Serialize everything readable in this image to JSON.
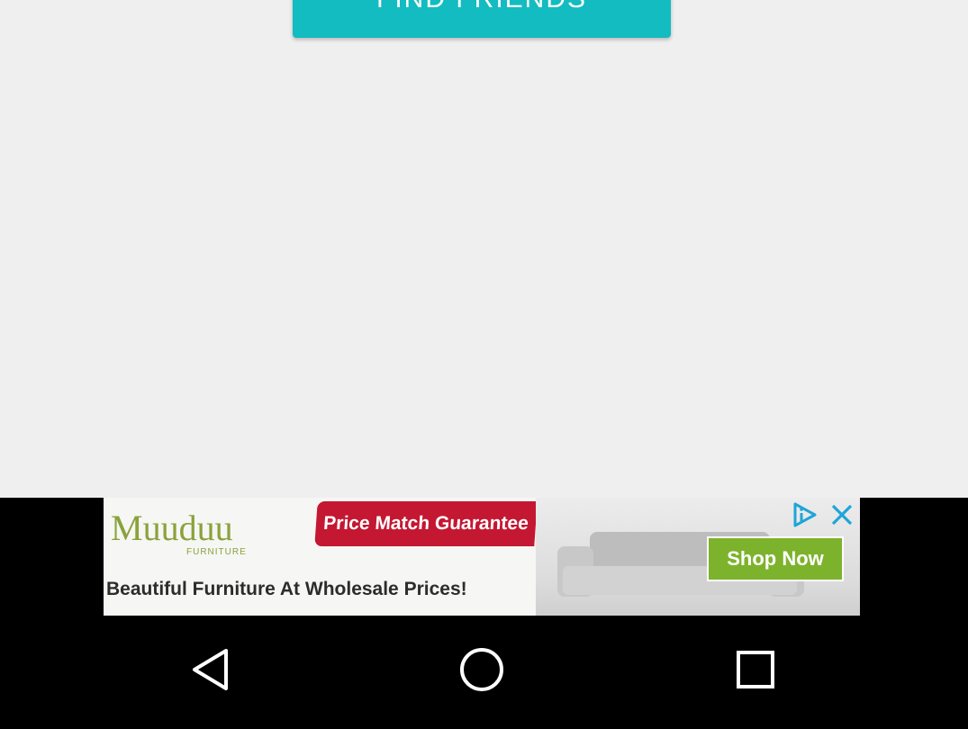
{
  "main": {
    "find_friends_label": "FIND FRIENDS"
  },
  "ad": {
    "brand_name": "Muuduu",
    "brand_subtitle": "FURNITURE",
    "price_match": "Price Match Guarantee",
    "tagline": "Beautiful Furniture At Wholesale Prices!",
    "cta_label": "Shop Now",
    "ad_choices_icon": "ad-choices-icon",
    "close_icon": "close-icon",
    "colors": {
      "brand": "#8aa23c",
      "price_banner": "#c41732",
      "cta": "#7db32c",
      "ad_icons": "#1ea5d8"
    }
  },
  "nav": {
    "back_icon": "back-triangle-icon",
    "home_icon": "home-circle-icon",
    "recents_icon": "recents-square-icon"
  },
  "colors": {
    "accent": "#12bcc0",
    "background": "#efefef",
    "system_bar": "#000000"
  }
}
